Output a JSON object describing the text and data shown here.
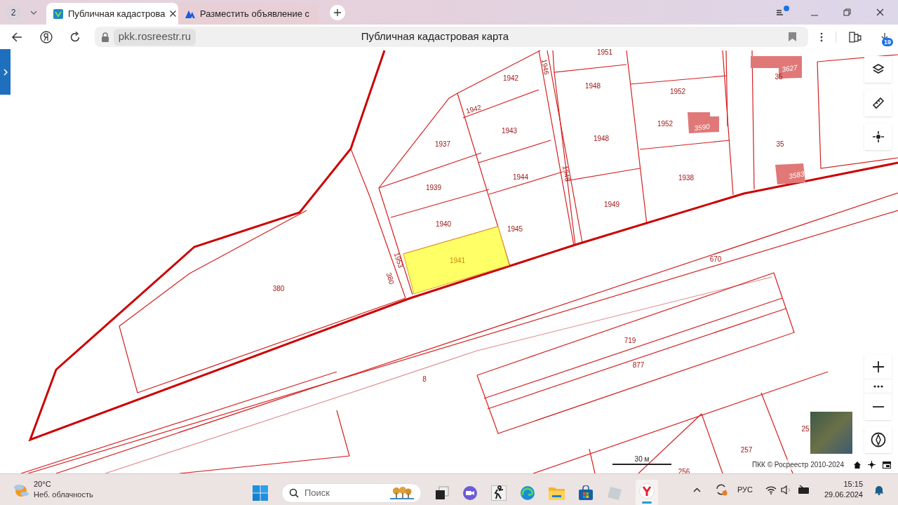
{
  "browser": {
    "tab_count": "2",
    "tabs": [
      {
        "title": "Публичная кадастрова",
        "selected": true
      },
      {
        "title": "Разместить объявление с",
        "selected": false
      }
    ],
    "address": {
      "domain": "pkk.rosreestr.ru",
      "page_title": "Публичная кадастровая карта"
    },
    "download_count": "19"
  },
  "map": {
    "labels": [
      {
        "text": "1951",
        "kind": "parcel",
        "selected": false
      },
      {
        "text": "1942",
        "kind": "parcel",
        "selected": false
      },
      {
        "text": "1946",
        "kind": "parcel",
        "selected": false
      },
      {
        "text": "1948",
        "kind": "parcel",
        "selected": false
      },
      {
        "text": "1952",
        "kind": "parcel",
        "selected": false
      },
      {
        "text": "3627",
        "kind": "building",
        "selected": false
      },
      {
        "text": "35",
        "kind": "parcel",
        "selected": false
      },
      {
        "text": "1942",
        "kind": "parcel",
        "selected": false
      },
      {
        "text": "1943",
        "kind": "parcel",
        "selected": false
      },
      {
        "text": "1952",
        "kind": "parcel",
        "selected": false
      },
      {
        "text": "3590",
        "kind": "building",
        "selected": false
      },
      {
        "text": "1937",
        "kind": "parcel",
        "selected": false
      },
      {
        "text": "1948",
        "kind": "parcel",
        "selected": false
      },
      {
        "text": "35",
        "kind": "parcel",
        "selected": false
      },
      {
        "text": "1939",
        "kind": "parcel",
        "selected": false
      },
      {
        "text": "1944",
        "kind": "parcel",
        "selected": false
      },
      {
        "text": "1946",
        "kind": "parcel",
        "selected": false
      },
      {
        "text": "1938",
        "kind": "parcel",
        "selected": false
      },
      {
        "text": "3583",
        "kind": "building",
        "selected": false
      },
      {
        "text": "1949",
        "kind": "parcel",
        "selected": false
      },
      {
        "text": "1940",
        "kind": "parcel",
        "selected": false
      },
      {
        "text": "1945",
        "kind": "parcel",
        "selected": false
      },
      {
        "text": "1941",
        "kind": "parcel",
        "selected": true
      },
      {
        "text": "1953",
        "kind": "parcel",
        "selected": false
      },
      {
        "text": "670",
        "kind": "parcel",
        "selected": false
      },
      {
        "text": "380",
        "kind": "parcel",
        "selected": false
      },
      {
        "text": "380",
        "kind": "parcel",
        "selected": false
      },
      {
        "text": "719",
        "kind": "parcel",
        "selected": false
      },
      {
        "text": "877",
        "kind": "parcel",
        "selected": false
      },
      {
        "text": "8",
        "kind": "parcel",
        "selected": false
      },
      {
        "text": "25",
        "kind": "parcel",
        "selected": false
      },
      {
        "text": "257",
        "kind": "parcel",
        "selected": false
      },
      {
        "text": "256",
        "kind": "parcel",
        "selected": false
      }
    ],
    "scale": "30 м",
    "attribution": "ПКК © Росреестр 2010-2024"
  },
  "taskbar": {
    "temperature": "20°C",
    "weather": "Неб. облачность",
    "search_placeholder": "Поиск",
    "language": "РУС",
    "time": "15:15",
    "date": "29.06.2024"
  }
}
